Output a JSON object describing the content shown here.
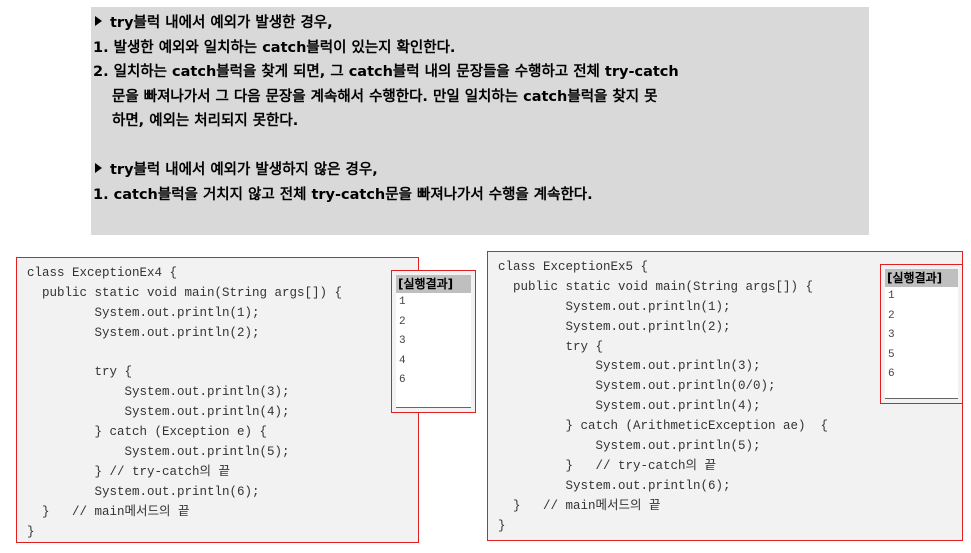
{
  "rules": {
    "catch_case_heading": "try블럭 내에서 예외가 발생한 경우,",
    "catch_case_items": [
      "1. 발생한 예외와 일치하는 catch블럭이 있는지 확인한다.",
      "2. 일치하는 catch블럭을 찾게 되면, 그 catch블럭 내의 문장들을 수행하고 전체 try-catch",
      "문을 빠져나가서 그 다음 문장을 계속해서 수행한다. 만일 일치하는 catch블럭을 찾지 못",
      "하면, 예외는 처리되지 못한다."
    ],
    "no_exception_heading": "try블럭 내에서 예외가 발생하지 않은 경우,",
    "no_exception_items": [
      "1. catch블럭을 거치지 않고 전체 try-catch문을 빠져나가서 수행을 계속한다."
    ]
  },
  "example1": {
    "code": [
      "class ExceptionEx4 {",
      "  public static void main(String args[]) {",
      "         System.out.println(1);",
      "         System.out.println(2);",
      "",
      "         try {",
      "             System.out.println(3);",
      "             System.out.println(4);",
      "         } catch (Exception e) {",
      "             System.out.println(5);",
      "         } // try-catch의 끝",
      "         System.out.println(6);",
      "  }   // main메서드의 끝",
      "}"
    ],
    "result_title": "[실행결과]",
    "result_lines": [
      "1",
      "2",
      "3",
      "4",
      "6"
    ]
  },
  "example2": {
    "code": [
      "class ExceptionEx5 {",
      "  public static void main(String args[]) {",
      "         System.out.println(1);",
      "         System.out.println(2);",
      "         try {",
      "             System.out.println(3);",
      "             System.out.println(0/0);",
      "             System.out.println(4);",
      "         } catch (ArithmeticException ae)  {",
      "             System.out.println(5);",
      "         }   // try-catch의 끝",
      "         System.out.println(6);",
      "  }   // main메서드의 끝",
      "}"
    ],
    "result_title": "[실행결과]",
    "result_lines": [
      "1",
      "2",
      "3",
      "5",
      "6"
    ]
  }
}
